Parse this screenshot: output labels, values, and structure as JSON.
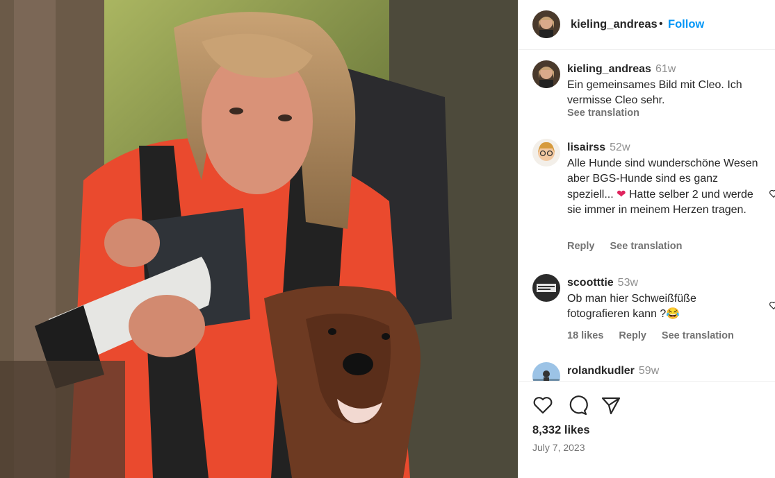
{
  "post": {
    "photo_description_icon": "photo-image",
    "header": {
      "username": "kieling_andreas",
      "separator": "•",
      "follow_label": "Follow"
    },
    "caption": {
      "username": "kieling_andreas",
      "time": "61w",
      "text": "Ein gemeinsames Bild mit Cleo. Ich vermisse Cleo sehr.",
      "see_translation": "See translation"
    },
    "comments": [
      {
        "username": "lisairss",
        "time": "52w",
        "text_before": "Alle Hunde sind wunderschöne Wesen aber BGS-Hunde sind es ganz speziell... ",
        "emoji": "❤",
        "text_after": " Hatte selber 2 und werde sie immer in meinem Herzen tragen.",
        "reply": "Reply",
        "see_translation": "See translation"
      },
      {
        "username": "scootttie",
        "time": "53w",
        "text": "Ob man hier Schweißfüße fotografieren kann ?😂",
        "likes": "18 likes",
        "reply": "Reply",
        "see_translation": "See translation"
      },
      {
        "username": "rolandkudler",
        "time": "59w"
      }
    ],
    "likes": "8,332 likes",
    "date": "July 7, 2023",
    "colors": {
      "follow": "#0095f6",
      "text": "#262626",
      "muted": "#737373",
      "heart": "#e0245e"
    }
  }
}
